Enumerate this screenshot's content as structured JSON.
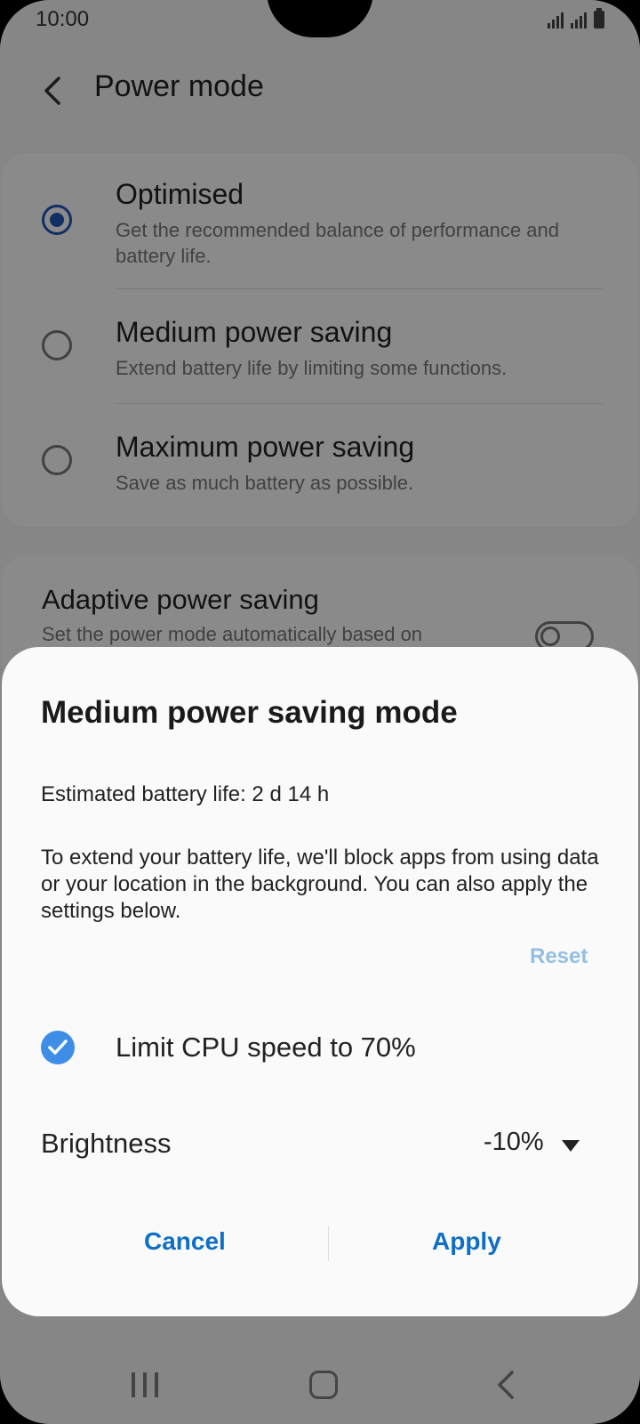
{
  "status_bar": {
    "time": "10:00"
  },
  "app_bar": {
    "title": "Power mode"
  },
  "power_modes": [
    {
      "title": "Optimised",
      "subtitle": "Get the recommended balance of performance and battery life.",
      "selected": true
    },
    {
      "title": "Medium power saving",
      "subtitle": "Extend battery life by limiting some functions.",
      "selected": false
    },
    {
      "title": "Maximum power saving",
      "subtitle": "Save as much battery as possible.",
      "selected": false
    }
  ],
  "adaptive": {
    "title": "Adaptive power saving",
    "subtitle": "Set the power mode automatically based on",
    "enabled": false
  },
  "dialog": {
    "title": "Medium power saving mode",
    "estimate": "Estimated battery life: 2 d 14 h",
    "description": "To extend your battery life, we'll block apps from using data or your location in the background. You can also apply the settings below.",
    "reset_label": "Reset",
    "cpu_label": "Limit CPU speed to 70%",
    "cpu_checked": true,
    "brightness_label": "Brightness",
    "brightness_value": "-10%",
    "cancel_label": "Cancel",
    "apply_label": "Apply"
  },
  "colors": {
    "accent": "#1f57b8",
    "button": "#0f6fc6",
    "check": "#3e8ee8",
    "reset": "#93bfe6"
  },
  "icons": {
    "back": "chevron-left-icon",
    "nav_recents": "recents-icon",
    "nav_home": "home-icon",
    "nav_back": "back-icon",
    "dropdown": "dropdown-triangle-icon",
    "check": "checkmark-icon"
  }
}
